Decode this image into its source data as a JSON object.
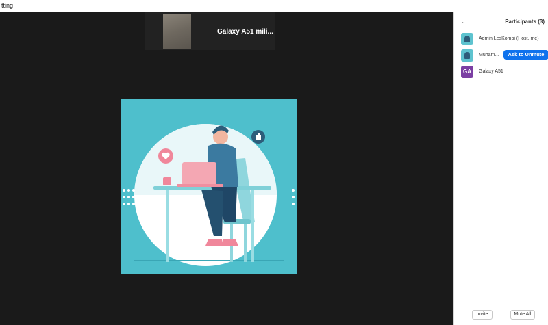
{
  "window": {
    "title": "tting"
  },
  "thumbnail": {
    "name": "Galaxy A51 mili..."
  },
  "participants": {
    "header": "Participants (3)",
    "items": [
      {
        "name": "Admin LesKompi (Host, me)",
        "avatar": "photo"
      },
      {
        "name": "Muham...",
        "avatar": "photo",
        "action": "Ask to Unmute"
      },
      {
        "name": "Galaxy A51",
        "avatar": "GA",
        "avatar_color": "#7b3fa3"
      }
    ],
    "invite_label": "Invite",
    "mute_all_label": "Mute All"
  },
  "colors": {
    "accent": "#0e72ed",
    "video_bg": "#1a1a1a",
    "share_bg": "#4ebfcc"
  }
}
